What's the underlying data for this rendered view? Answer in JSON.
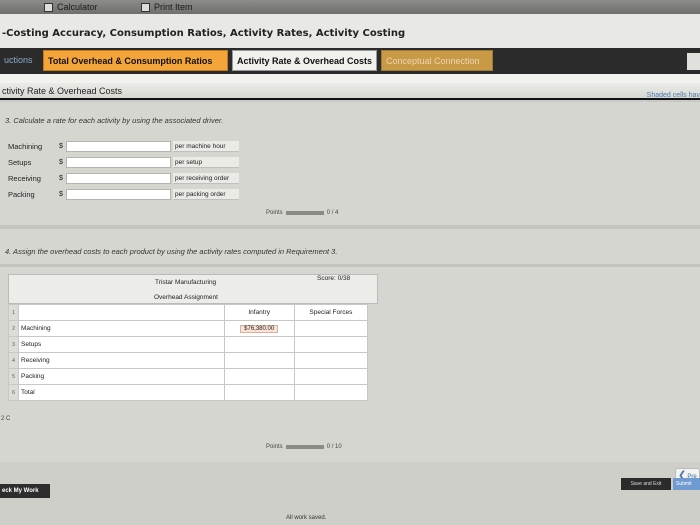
{
  "toolbar": {
    "calculator": "Calculator",
    "print_item": "Print Item"
  },
  "header": {
    "title": "-Costing Accuracy, Consumption Ratios, Activity Rates, Activity Costing"
  },
  "tabs": [
    {
      "label": "uctions"
    },
    {
      "label": "Total Overhead & Consumption Ratios"
    },
    {
      "label": "Activity Rate & Overhead Costs"
    },
    {
      "label": "Conceptual Connection"
    }
  ],
  "section": {
    "title": "ctivity Rate & Overhead Costs",
    "shaded_note": "Shaded cells hav"
  },
  "req3": {
    "instruction": "3. Calculate a rate for each activity by using the associated driver.",
    "rows": [
      {
        "label": "Machining",
        "currency": "$",
        "value": "",
        "unit": "per machine hour"
      },
      {
        "label": "Setups",
        "currency": "$",
        "value": "",
        "unit": "per setup"
      },
      {
        "label": "Receiving",
        "currency": "$",
        "value": "",
        "unit": "per receiving order"
      },
      {
        "label": "Packing",
        "currency": "$",
        "value": "",
        "unit": "per packing order"
      }
    ],
    "points_label": "Points",
    "points_value": "0 / 4"
  },
  "req4": {
    "instruction": "4. Assign the overhead costs to each product by using the activity rates computed in Requirement 3.",
    "company": "Tristar Manufacturing",
    "sheet_title": "Overhead Assignment",
    "score": "Score: 0/38",
    "col_headers": [
      "Infantry",
      "Special Forces"
    ],
    "rows": [
      {
        "num": "1",
        "label": "",
        "c1": "",
        "c2": ""
      },
      {
        "num": "2",
        "label": "Machining",
        "c1": "$76,380.00",
        "c2": ""
      },
      {
        "num": "3",
        "label": "Setups",
        "c1": "",
        "c2": ""
      },
      {
        "num": "4",
        "label": "Receiving",
        "c1": "",
        "c2": ""
      },
      {
        "num": "5",
        "label": "Packing",
        "c1": "",
        "c2": ""
      },
      {
        "num": "6",
        "label": "Total",
        "c1": "",
        "c2": ""
      }
    ],
    "side_label": "2 C",
    "points_label": "Points",
    "points_value": "0 / 10"
  },
  "footer": {
    "check_work": "eck My Work",
    "saved": "All work saved.",
    "prev": "Pre",
    "save_exit": "Save and Exit",
    "submit": "Submit"
  }
}
